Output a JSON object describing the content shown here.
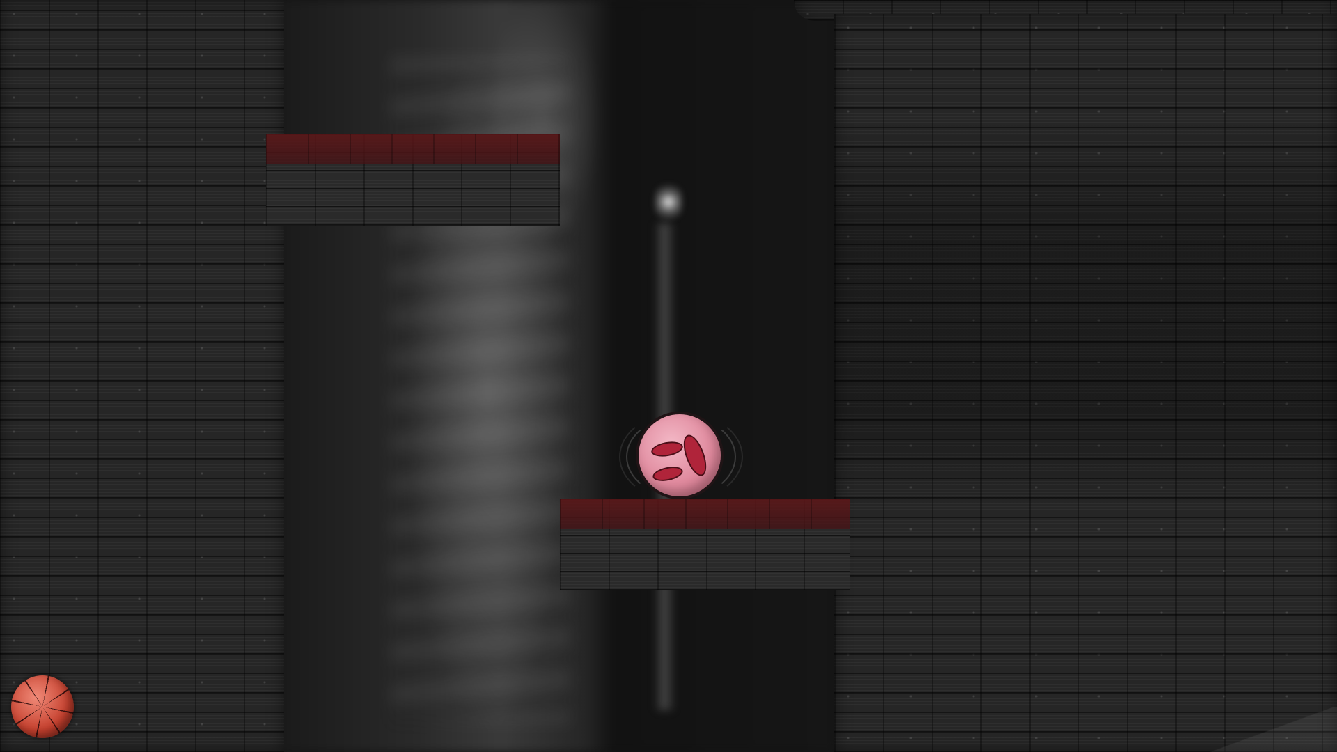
{
  "game": {
    "player": {
      "sprite": "pink-spotted-ball",
      "color": "#e08a9e",
      "spot_color": "#b0243a"
    },
    "hud": {
      "lives_icon": "red-segmented-ball-icon",
      "lives_color": "#c5402e"
    },
    "hazards": {
      "danger_strip_color": "#5f1618"
    },
    "level": {
      "theme": "dark brick shaft"
    }
  }
}
